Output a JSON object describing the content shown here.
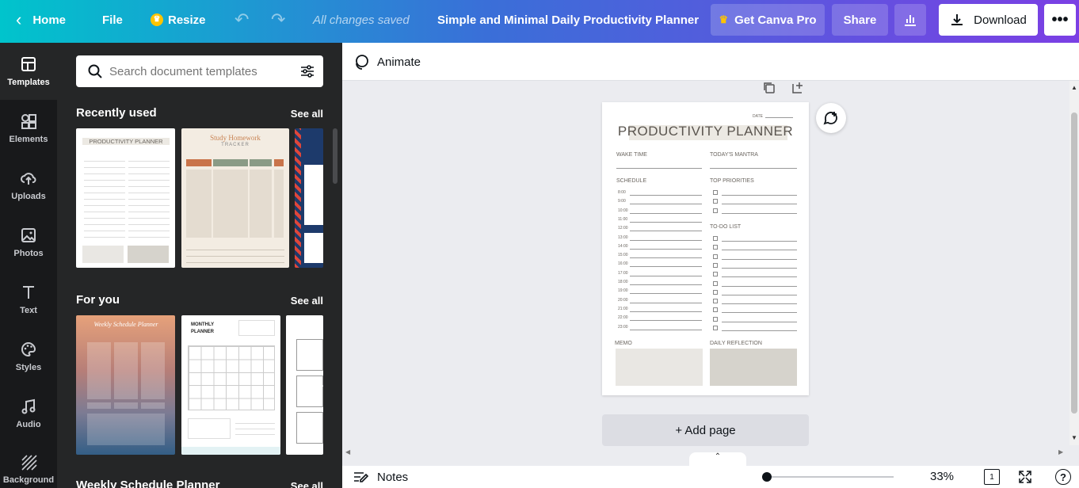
{
  "topbar": {
    "home": "Home",
    "file": "File",
    "resize": "Resize",
    "status": "All changes saved",
    "doc_title": "Simple and Minimal Daily Productivity Planner",
    "get_pro": "Get Canva Pro",
    "share": "Share",
    "download": "Download"
  },
  "rail": {
    "items": [
      {
        "label": "Templates",
        "icon": "templates-icon"
      },
      {
        "label": "Elements",
        "icon": "elements-icon"
      },
      {
        "label": "Uploads",
        "icon": "uploads-icon"
      },
      {
        "label": "Photos",
        "icon": "photos-icon"
      },
      {
        "label": "Text",
        "icon": "text-icon"
      },
      {
        "label": "Styles",
        "icon": "styles-icon"
      },
      {
        "label": "Audio",
        "icon": "audio-icon"
      },
      {
        "label": "Background",
        "icon": "background-icon"
      }
    ]
  },
  "panel": {
    "search_placeholder": "Search document templates",
    "sections": [
      {
        "title": "Recently used",
        "see_all": "See all"
      },
      {
        "title": "For you",
        "see_all": "See all"
      },
      {
        "title": "Weekly Schedule Planner",
        "see_all": "See all"
      }
    ],
    "thumbs": {
      "productivity_title": "PRODUCTIVITY PLANNER",
      "study_title": "Study Homework",
      "study_sub": "TRACKER",
      "weekly_title": "Weekly Schedule Planner",
      "monthly_title": "MONTHLY PLANNER"
    }
  },
  "editor": {
    "animate": "Animate",
    "add_page": "+ Add page",
    "notes": "Notes",
    "zoom": "33%",
    "page_count": "1"
  },
  "planner": {
    "date": "DATE",
    "title": "PRODUCTIVITY PLANNER",
    "wake_time": "WAKE TIME",
    "mantra": "TODAY'S MANTRA",
    "schedule": "SCHEDULE",
    "top_priorities": "TOP PRIORITIES",
    "todo": "TO-DO LIST",
    "memo": "MEMO",
    "reflection": "DAILY REFLECTION",
    "hours": [
      "8:00",
      "9:00",
      "10:00",
      "11:00",
      "12:00",
      "13:00",
      "14:00",
      "15:00",
      "16:00",
      "17:00",
      "18:00",
      "19:00",
      "20:00",
      "21:00",
      "22:00",
      "23:00"
    ]
  },
  "colors": {
    "rail_bg": "#18191b",
    "panel_bg": "#252627",
    "accent": "#8b3dff",
    "planner_box": "#e9e7e3",
    "planner_box_dark": "#d6d3cc"
  }
}
